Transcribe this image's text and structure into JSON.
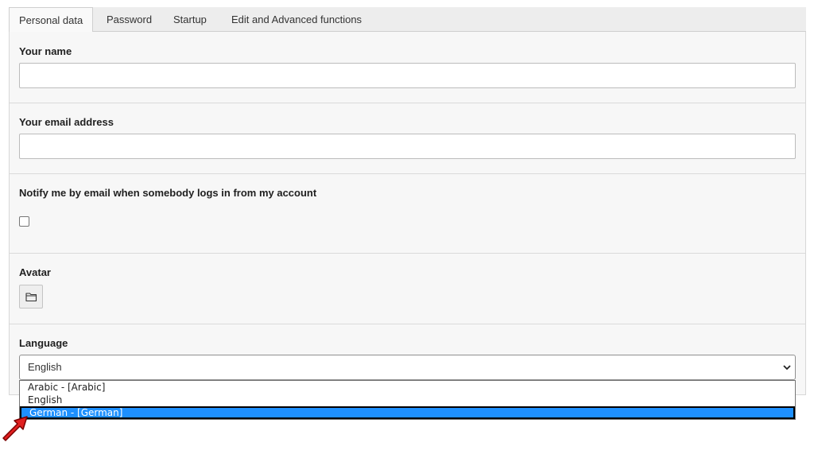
{
  "tabs": [
    {
      "label": "Personal data",
      "active": true
    },
    {
      "label": "Password",
      "active": false
    },
    {
      "label": "Startup",
      "active": false
    },
    {
      "label": "Edit and Advanced functions",
      "active": false
    }
  ],
  "fields": {
    "name": {
      "label": "Your name",
      "value": ""
    },
    "email": {
      "label": "Your email address",
      "value": ""
    },
    "notify": {
      "label": "Notify me by email when somebody logs in from my account",
      "checked": false
    },
    "avatar": {
      "label": "Avatar",
      "icon": "folder-icon"
    },
    "language": {
      "label": "Language",
      "selected": "English",
      "options": [
        "Arabic - [Arabic]",
        "English",
        "German - [German]"
      ],
      "highlighted": "German - [German]"
    }
  },
  "colors": {
    "highlight": "#1e90ff",
    "pointer_arrow": "#e02020"
  }
}
